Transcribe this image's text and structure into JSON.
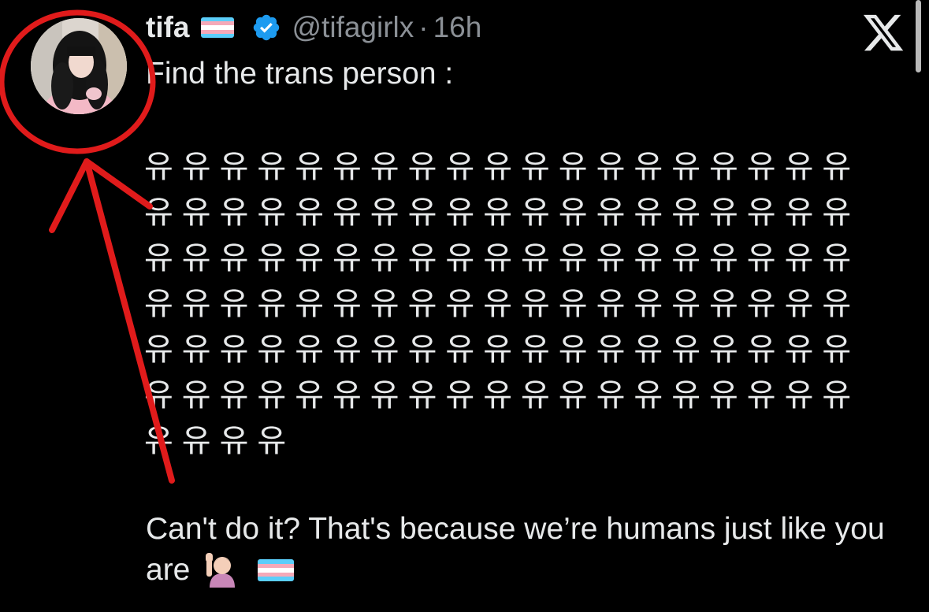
{
  "tweet": {
    "display_name": "tifa",
    "handle": "@tifagirlx",
    "separator": "·",
    "time": "16h",
    "intro_text": "Find the trans person :",
    "glyph_rows": [
      "유유유유유유유유유유유유유유유유유유유",
      "유유유유유유유유유유유유유유유유유유유",
      "유유유유유유유유유유유유유유유유유유유",
      "유유유유유유유유유유유유유유유유유유유",
      "유유유유유유유유유유유유유유유유유유유",
      "유유유유유유유유유유유유유유유유유유유",
      "유유유유"
    ],
    "outro_text": "Can't do it? That's because we’re humans just like you are",
    "emojis": [
      "raising-hand-emoji",
      "transgender-flag-emoji"
    ]
  },
  "icons": {
    "avatar": "profile-photo",
    "flag": "transgender-flag-icon",
    "verified": "verified-badge-icon",
    "logo": "x-logo-icon"
  },
  "colors": {
    "background": "#000000",
    "text": "#e7e9ea",
    "secondary_text": "#8b9096",
    "verified_blue": "#1d9bf0",
    "annotation_red": "#e01b1b",
    "flag_blue": "#5bcefa",
    "flag_pink": "#f5a9b8",
    "flag_white": "#ffffff"
  }
}
